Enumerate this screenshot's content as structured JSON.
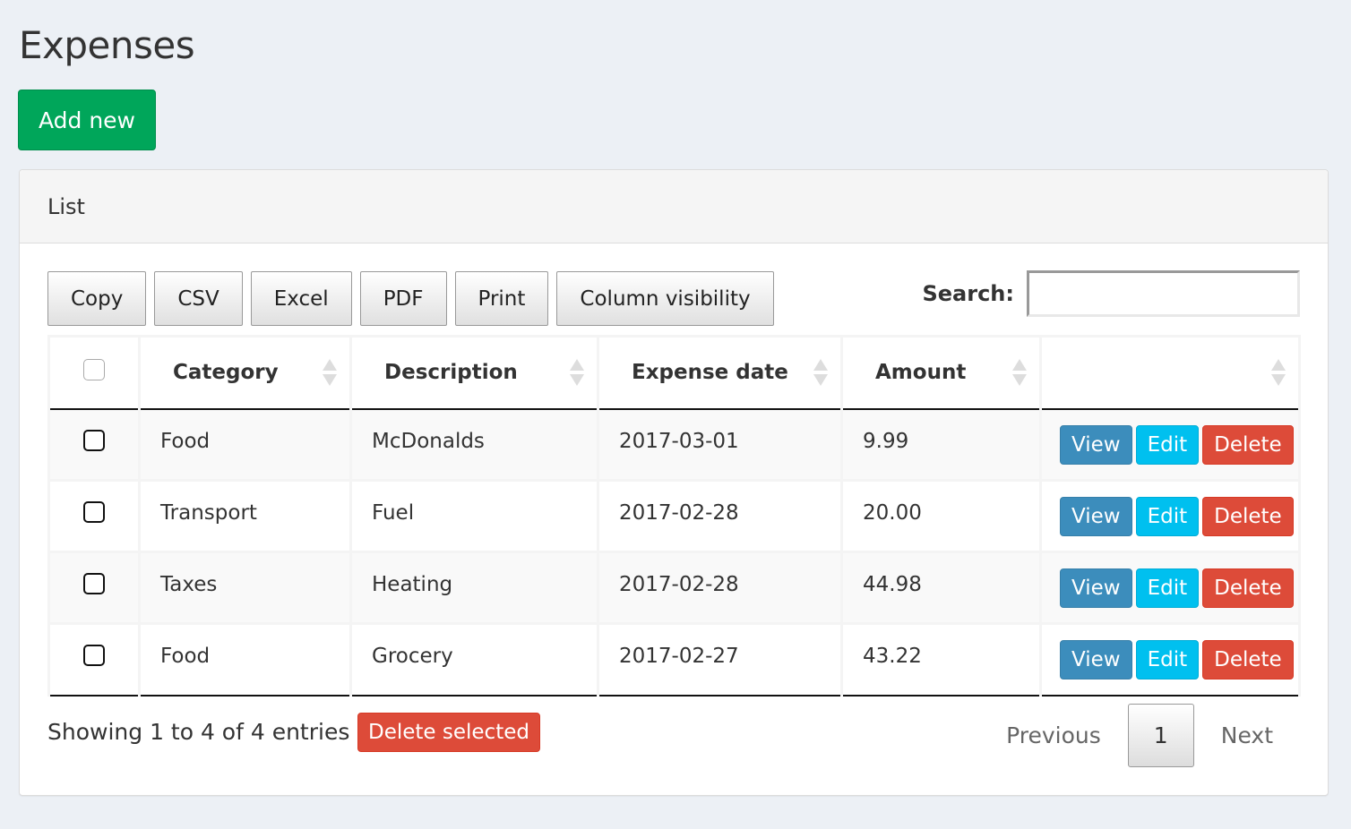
{
  "page": {
    "title": "Expenses",
    "add_button": "Add new"
  },
  "panel": {
    "heading": "List"
  },
  "toolbar": {
    "buttons": [
      "Copy",
      "CSV",
      "Excel",
      "PDF",
      "Print",
      "Column visibility"
    ],
    "search_label": "Search:",
    "search_value": "",
    "search_placeholder": ""
  },
  "table": {
    "columns": [
      "",
      "Category",
      "Description",
      "Expense date",
      "Amount",
      ""
    ],
    "rows": [
      {
        "category": "Food",
        "description": "McDonalds",
        "date": "2017-03-01",
        "amount": "9.99"
      },
      {
        "category": "Transport",
        "description": "Fuel",
        "date": "2017-02-28",
        "amount": "20.00"
      },
      {
        "category": "Taxes",
        "description": "Heating",
        "date": "2017-02-28",
        "amount": "44.98"
      },
      {
        "category": "Food",
        "description": "Grocery",
        "date": "2017-02-27",
        "amount": "43.22"
      }
    ],
    "actions": {
      "view": "View",
      "edit": "Edit",
      "delete": "Delete"
    }
  },
  "footer": {
    "info": "Showing 1 to 4 of 4 entries",
    "delete_selected": "Delete selected",
    "pagination": {
      "previous": "Previous",
      "current": "1",
      "next": "Next"
    }
  },
  "colors": {
    "background": "#ecf0f5",
    "success": "#00a65a",
    "primary": "#3c8dbc",
    "info": "#00c0ef",
    "danger": "#dd4b39"
  }
}
